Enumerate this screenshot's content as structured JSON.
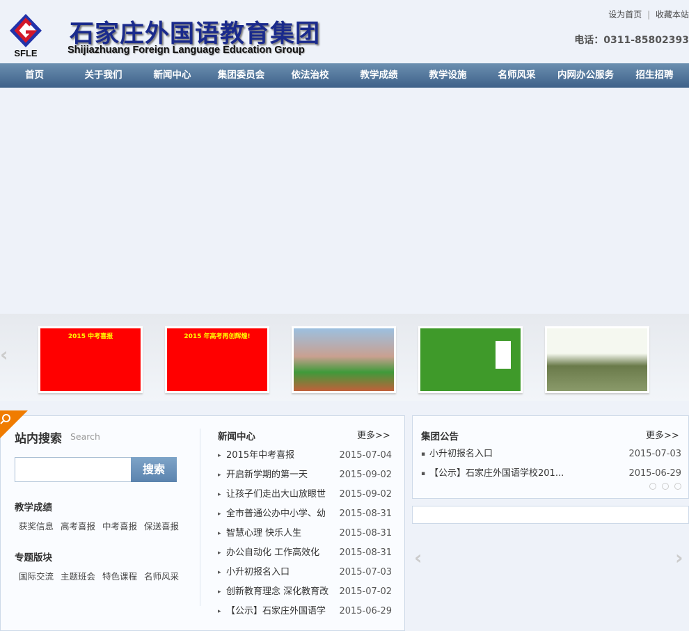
{
  "header": {
    "logo_text": "SFLE",
    "title_cn": "石家庄外国语教育集团",
    "title_en": "Shijiazhuang Foreign Language Education Group",
    "set_home": "设为首页",
    "separator": "|",
    "bookmark": "收藏本站",
    "phone": "电话：0311-85802393"
  },
  "nav": [
    "首页",
    "关于我们",
    "新闻中心",
    "集团委员会",
    "依法治校",
    "教学成绩",
    "教学设施",
    "名师风采",
    "内网办公服务",
    "招生招聘"
  ],
  "thumbs": [
    {
      "caption": "2015 中考喜报",
      "color": "#ff0000"
    },
    {
      "caption": "2015 年高考再创辉煌!",
      "color": "#ff0000"
    },
    {
      "caption": "",
      "color": "#8fb0d0"
    },
    {
      "caption": "",
      "color": "#3f9a2a"
    },
    {
      "caption": "",
      "color": "#e8eee0"
    }
  ],
  "search": {
    "title": "站内搜索",
    "subtitle": "Search",
    "input_value": "",
    "button": "搜索"
  },
  "teaching": {
    "title": "教学成绩",
    "links": [
      "获奖信息",
      "高考喜报",
      "中考喜报",
      "保送喜报"
    ]
  },
  "topics": {
    "title": "专题版块",
    "links": [
      "国际交流",
      "主题班会",
      "特色课程",
      "名师风采"
    ]
  },
  "news": {
    "title": "新闻中心",
    "more": "更多>>",
    "items": [
      {
        "title": "2015年中考喜报",
        "date": "2015-07-04"
      },
      {
        "title": "开启新学期的第一天",
        "date": "2015-09-02"
      },
      {
        "title": "让孩子们走出大山放眼世",
        "date": "2015-09-02"
      },
      {
        "title": "全市普通公办中小学、幼",
        "date": "2015-08-31"
      },
      {
        "title": "智慧心理 快乐人生",
        "date": "2015-08-31"
      },
      {
        "title": "办公自动化 工作高效化",
        "date": "2015-08-31"
      },
      {
        "title": "小升初报名入口",
        "date": "2015-07-03"
      },
      {
        "title": "创新教育理念 深化教育改",
        "date": "2015-07-02"
      },
      {
        "title": "【公示】石家庄外国语学",
        "date": "2015-06-29"
      }
    ]
  },
  "notice": {
    "title": "集团公告",
    "more": "更多>>",
    "items": [
      {
        "title": "小升初报名入口",
        "date": "2015-07-03"
      },
      {
        "title": "【公示】石家庄外国语学校201...",
        "date": "2015-06-29"
      }
    ]
  },
  "colors": {
    "nav": "#4a6d93",
    "accent": "#f07c00",
    "button": "#6a90b8"
  }
}
